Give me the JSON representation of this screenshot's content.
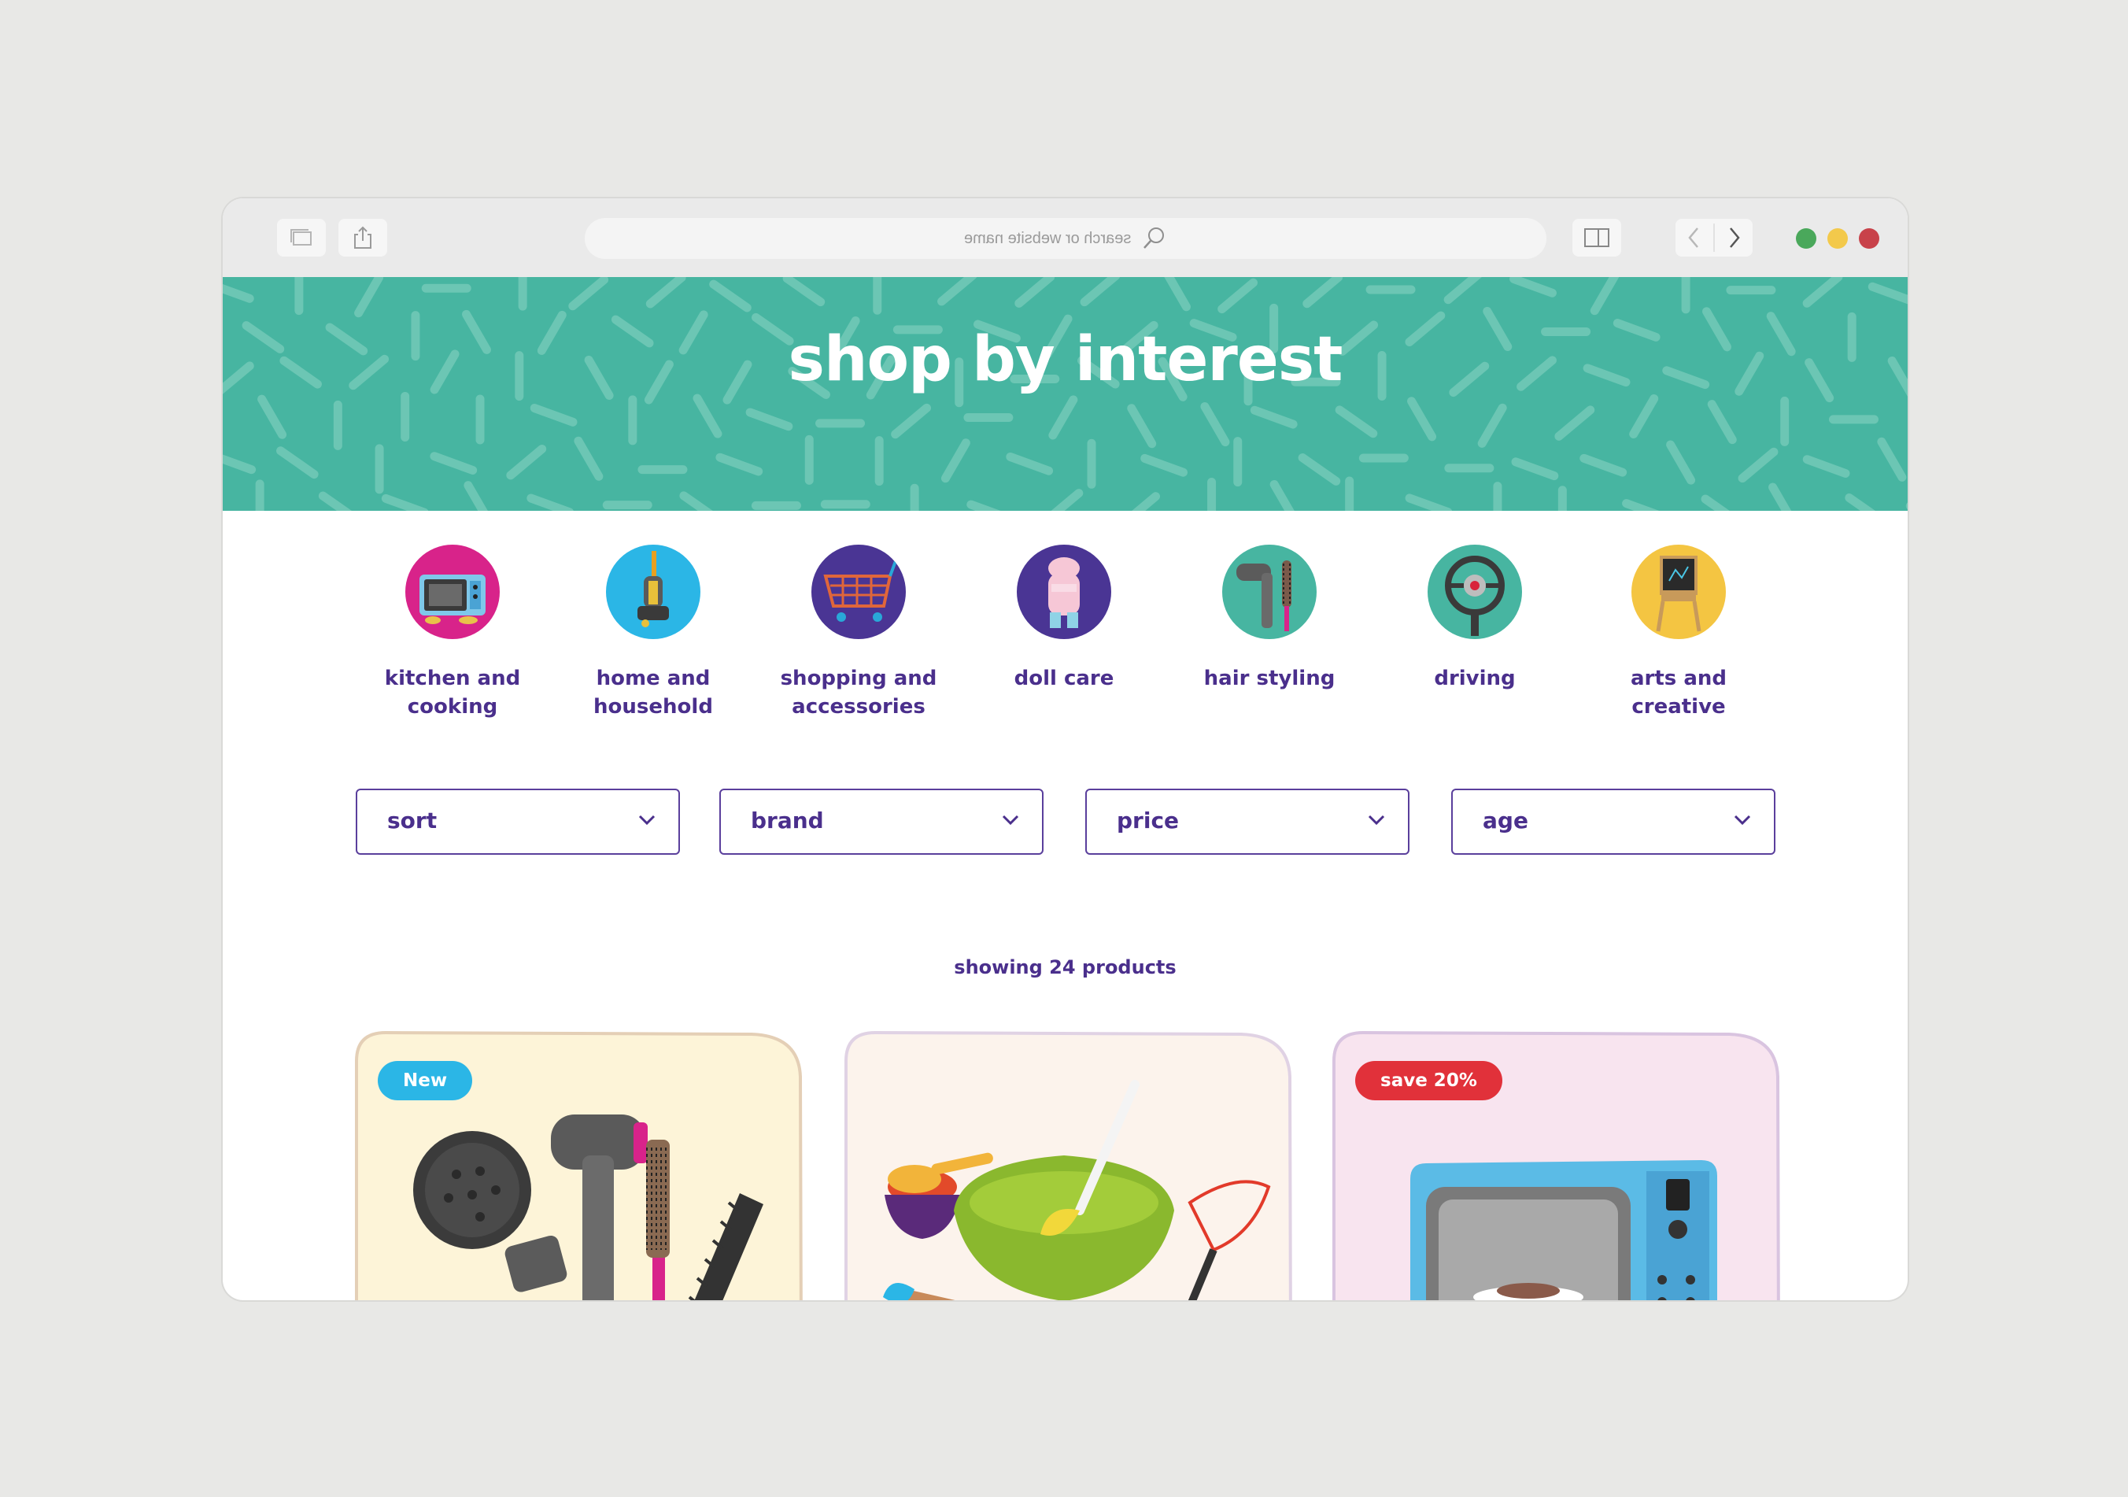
{
  "browser": {
    "address_placeholder": "search or website name",
    "traffic_lights": [
      "#4aa85b",
      "#f3c94b",
      "#c8424a"
    ]
  },
  "hero": {
    "title": "shop by interest",
    "background": "#47b5a1"
  },
  "categories": [
    {
      "label": "kitchen and cooking",
      "icon": "microwave-icon",
      "color": "#d8238a"
    },
    {
      "label": "home and household",
      "icon": "vacuum-icon",
      "color": "#2bb6e6"
    },
    {
      "label": "shopping and accessories",
      "icon": "shopping-cart-icon",
      "color": "#4a3594"
    },
    {
      "label": "doll care",
      "icon": "doll-carrier-icon",
      "color": "#4a3594"
    },
    {
      "label": "hair styling",
      "icon": "hair-dryer-icon",
      "color": "#47b5a1"
    },
    {
      "label": "driving",
      "icon": "steering-wheel-icon",
      "color": "#47b5a1"
    },
    {
      "label": "arts and creative",
      "icon": "easel-icon",
      "color": "#f4c542"
    }
  ],
  "filters": [
    {
      "label": "sort"
    },
    {
      "label": "brand"
    },
    {
      "label": "price"
    },
    {
      "label": "age"
    }
  ],
  "results": {
    "count_text": "showing 24 products"
  },
  "products": [
    {
      "badge": "New",
      "badge_color": "#2bb6e6",
      "bg": "#fdf4d8",
      "image": "hair-styling-set"
    },
    {
      "badge": "",
      "badge_color": "",
      "bg": "#fcf3ec",
      "image": "baking-set"
    },
    {
      "badge": "save 20%",
      "badge_color": "#e1313a",
      "bg": "#f8e4ef",
      "image": "toy-microwave"
    }
  ],
  "colors": {
    "brand_purple": "#4a2f8c"
  }
}
